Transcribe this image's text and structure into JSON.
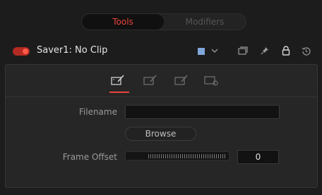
{
  "top_tabs": {
    "tools": "Tools",
    "modifiers": "Modifiers"
  },
  "tool": {
    "title": "Saver1: No Clip",
    "enabled": true,
    "swatch_color": "#7fa7d9"
  },
  "header_icons": [
    "chevron-down-icon",
    "version-icon",
    "pin-icon",
    "lock-icon",
    "reset-icon"
  ],
  "panel_tabs": [
    "file-tab-icon",
    "format-tab-icon",
    "export-tab-icon",
    "settings-tab-icon"
  ],
  "fields": {
    "filename_label": "Filename",
    "filename_value": "",
    "browse_label": "Browse",
    "frame_offset_label": "Frame Offset",
    "frame_offset_value": "0"
  },
  "colors": {
    "accent": "#e8453c",
    "swatch": "#7fa7d9"
  }
}
